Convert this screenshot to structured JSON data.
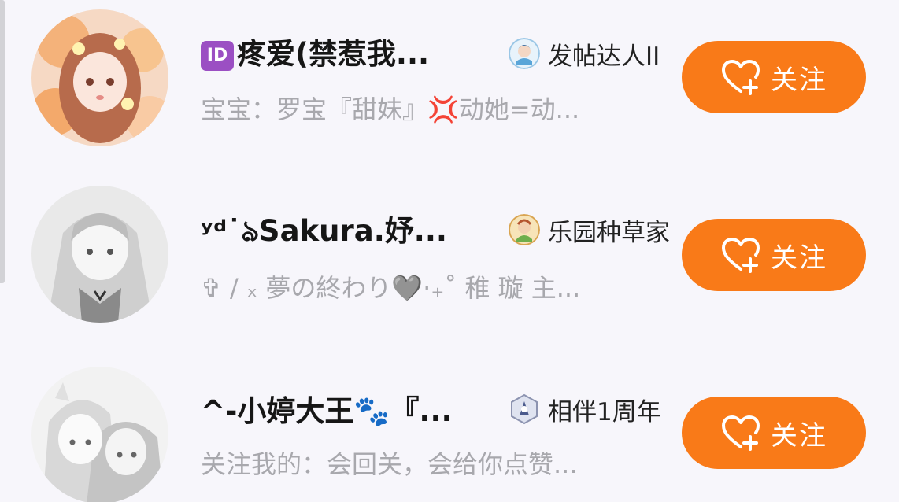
{
  "users": [
    {
      "badge": "ID",
      "name": "疼爱(禁惹我...",
      "medal": "发帖达人II",
      "signature": "宝宝：罗宝『甜妹』💢动她=动...",
      "follow": "关注"
    },
    {
      "badge": "",
      "name": "ʸᵈ˙ঌSakura.妤...",
      "medal": "乐园种草家",
      "signature": "✞ / ₓ 夢の終わり🩶⋅₊˚ 稚 璇 主...",
      "follow": "关注"
    },
    {
      "badge": "",
      "name": "^-小婷大王🐾『...",
      "medal": "相伴1周年",
      "signature": "关注我的：会回关，会给你点赞...",
      "follow": "关注"
    }
  ],
  "colors": {
    "accent": "#f97a18",
    "background": "#f7f6fb",
    "name_text": "#161616",
    "signature_text": "#a8a8ad",
    "id_badge": "#9b4fc3"
  },
  "icons": {
    "follow": "heart-plus-icon",
    "medals": [
      "poster-medal-icon",
      "seed-planter-medal-icon",
      "anniversary-medal-icon"
    ]
  }
}
